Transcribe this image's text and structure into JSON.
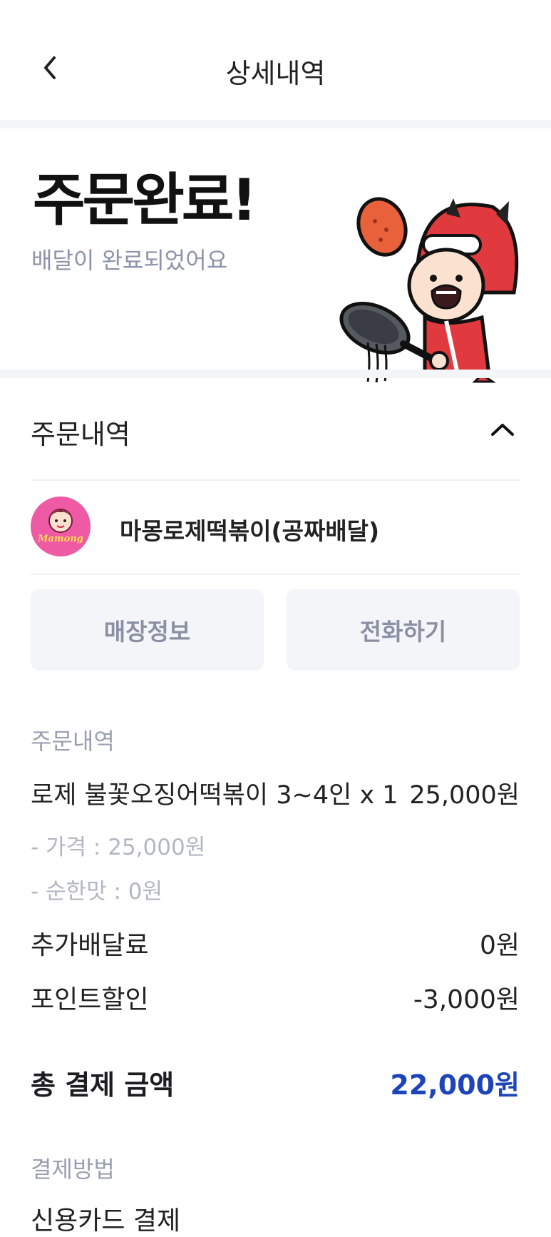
{
  "header": {
    "title": "상세내역"
  },
  "hero": {
    "title": "주문완료!",
    "subtitle": "배달이 완료되었어요"
  },
  "order_section": {
    "title": "주문내역"
  },
  "store": {
    "name": "마몽로제떡볶이(공짜배달)",
    "logo_text": "Mamong"
  },
  "actions": {
    "store_info": "매장정보",
    "call": "전화하기"
  },
  "order_details": {
    "label": "주문내역",
    "item": {
      "name": "로제 불꽃오징어떡볶이 3~4인 x 1",
      "price": "25,000원"
    },
    "options": [
      "- 가격 : 25,000원",
      "- 순한맛 : 0원"
    ],
    "extra_delivery": {
      "label": "추가배달료",
      "value": "0원"
    },
    "point_discount": {
      "label": "포인트할인",
      "value": "-3,000원"
    },
    "total": {
      "label": "총 결제 금액",
      "value": "22,000원"
    }
  },
  "payment": {
    "label": "결제방법",
    "method": "신용카드 결제"
  },
  "colors": {
    "accent": "#1d44b8",
    "gray_text": "#9aa0b3",
    "button_bg": "#f4f5f8",
    "logo_bg": "#ee5aa3"
  }
}
